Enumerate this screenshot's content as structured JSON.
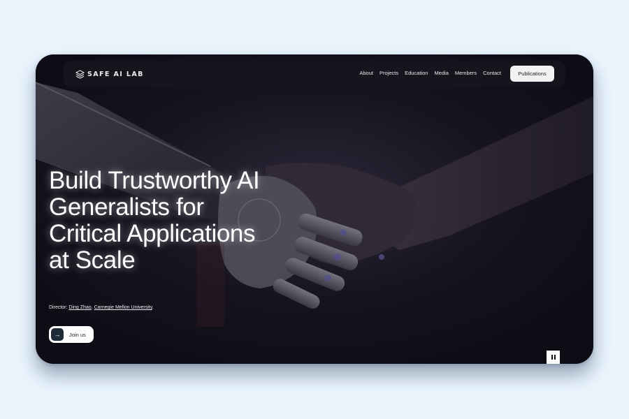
{
  "brand": {
    "logo_text": "SAFE AI LAB",
    "logo_icon": "stacked-layers-icon"
  },
  "nav": {
    "items": [
      {
        "label": "About"
      },
      {
        "label": "Projects"
      },
      {
        "label": "Education"
      },
      {
        "label": "Media"
      },
      {
        "label": "Members"
      },
      {
        "label": "Contact"
      }
    ],
    "cta_label": "Publications"
  },
  "hero": {
    "headline": "Build Trustworthy AI Generalists for Critical Applications at Scale",
    "director": {
      "prefix": "Director: ",
      "name": "Ding Zhao",
      "separator": ", ",
      "institution": "Carnegie Mellon University",
      "suffix": "."
    },
    "join_label": "Join us",
    "join_icon": "arrow-right-icon",
    "background": "robot-human-handshake-image",
    "video_control_icon": "pause-icon"
  },
  "colors": {
    "page_bg": "#e9f4fd",
    "hero_bg": "#12111a",
    "cta_bg": "#f2f2f2",
    "join_arrow_bg": "#1f2a38"
  }
}
